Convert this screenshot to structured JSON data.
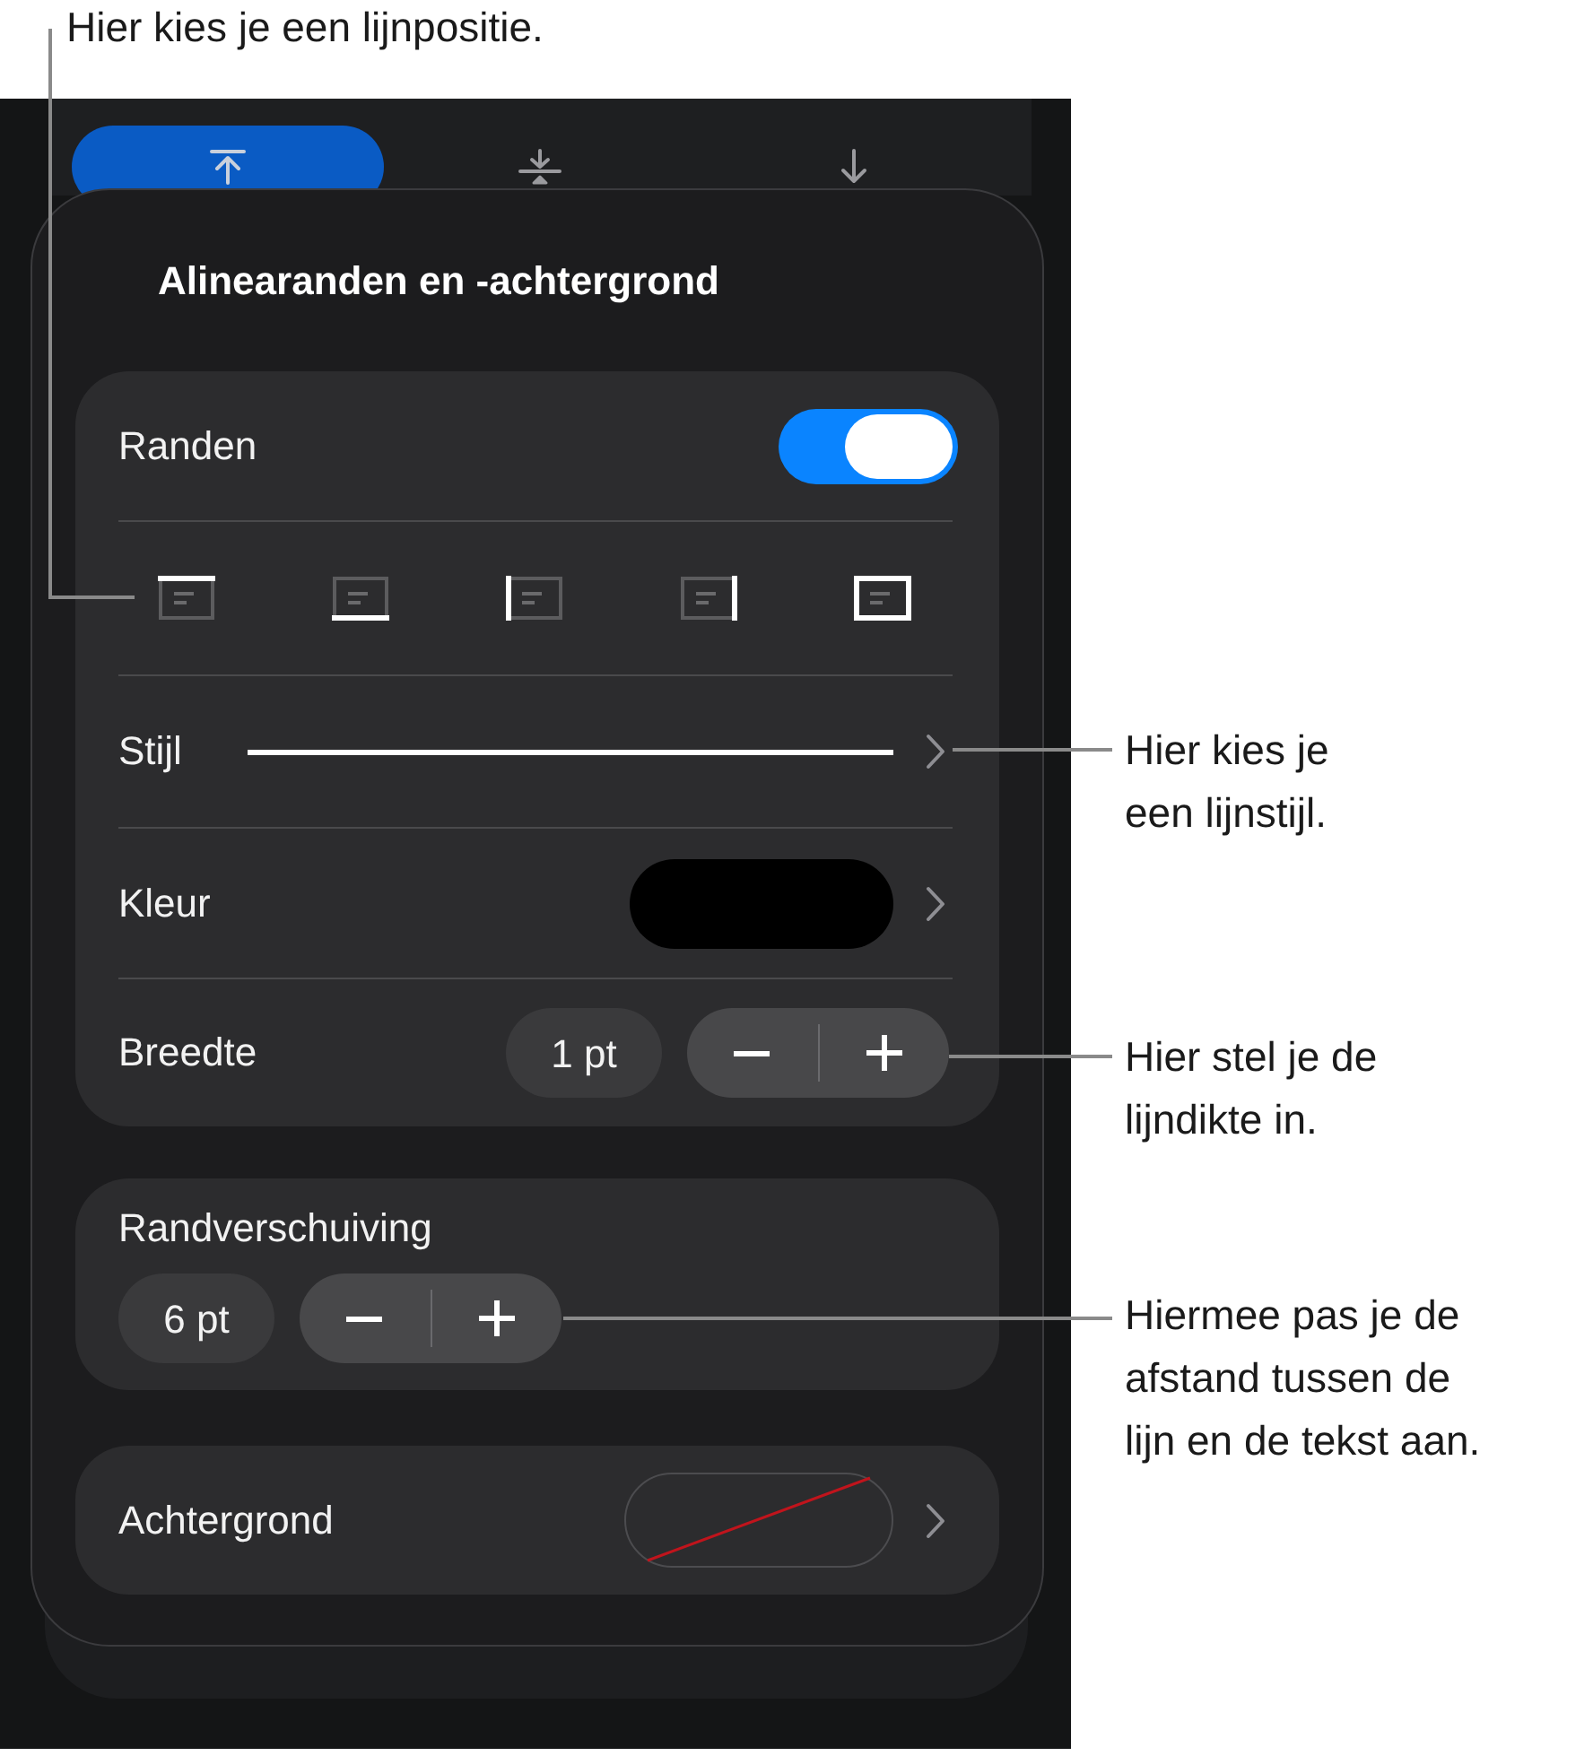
{
  "callout_top": {
    "text": "Hier kies je een lijnpositie."
  },
  "tab_bar": {
    "tabs": [
      {
        "kind": "top",
        "selected": true
      },
      {
        "kind": "middle",
        "selected": false
      },
      {
        "kind": "bottom",
        "selected": false
      }
    ]
  },
  "popover": {
    "title": "Alinearanden en -achtergrond",
    "borders": {
      "label": "Randen",
      "on": true,
      "positions": [
        {
          "kind": "top"
        },
        {
          "kind": "bottom"
        },
        {
          "kind": "left"
        },
        {
          "kind": "right"
        },
        {
          "kind": "all"
        }
      ],
      "style_row": {
        "label": "Stijl"
      },
      "color_row": {
        "label": "Kleur",
        "color": "#000000"
      },
      "width_row": {
        "label": "Breedte",
        "value": "1 pt"
      }
    },
    "offset": {
      "label": "Randverschuiving",
      "value": "6 pt"
    },
    "background": {
      "label": "Achtergrond"
    }
  },
  "callouts": [
    {
      "lines": [
        "Hier kies je",
        "een lijnstijl."
      ]
    },
    {
      "lines": [
        "Hier stel je de",
        "lijndikte in."
      ]
    },
    {
      "lines": [
        "Hiermee pas je de",
        "afstand tussen de",
        "lijn en de tekst aan."
      ]
    }
  ]
}
